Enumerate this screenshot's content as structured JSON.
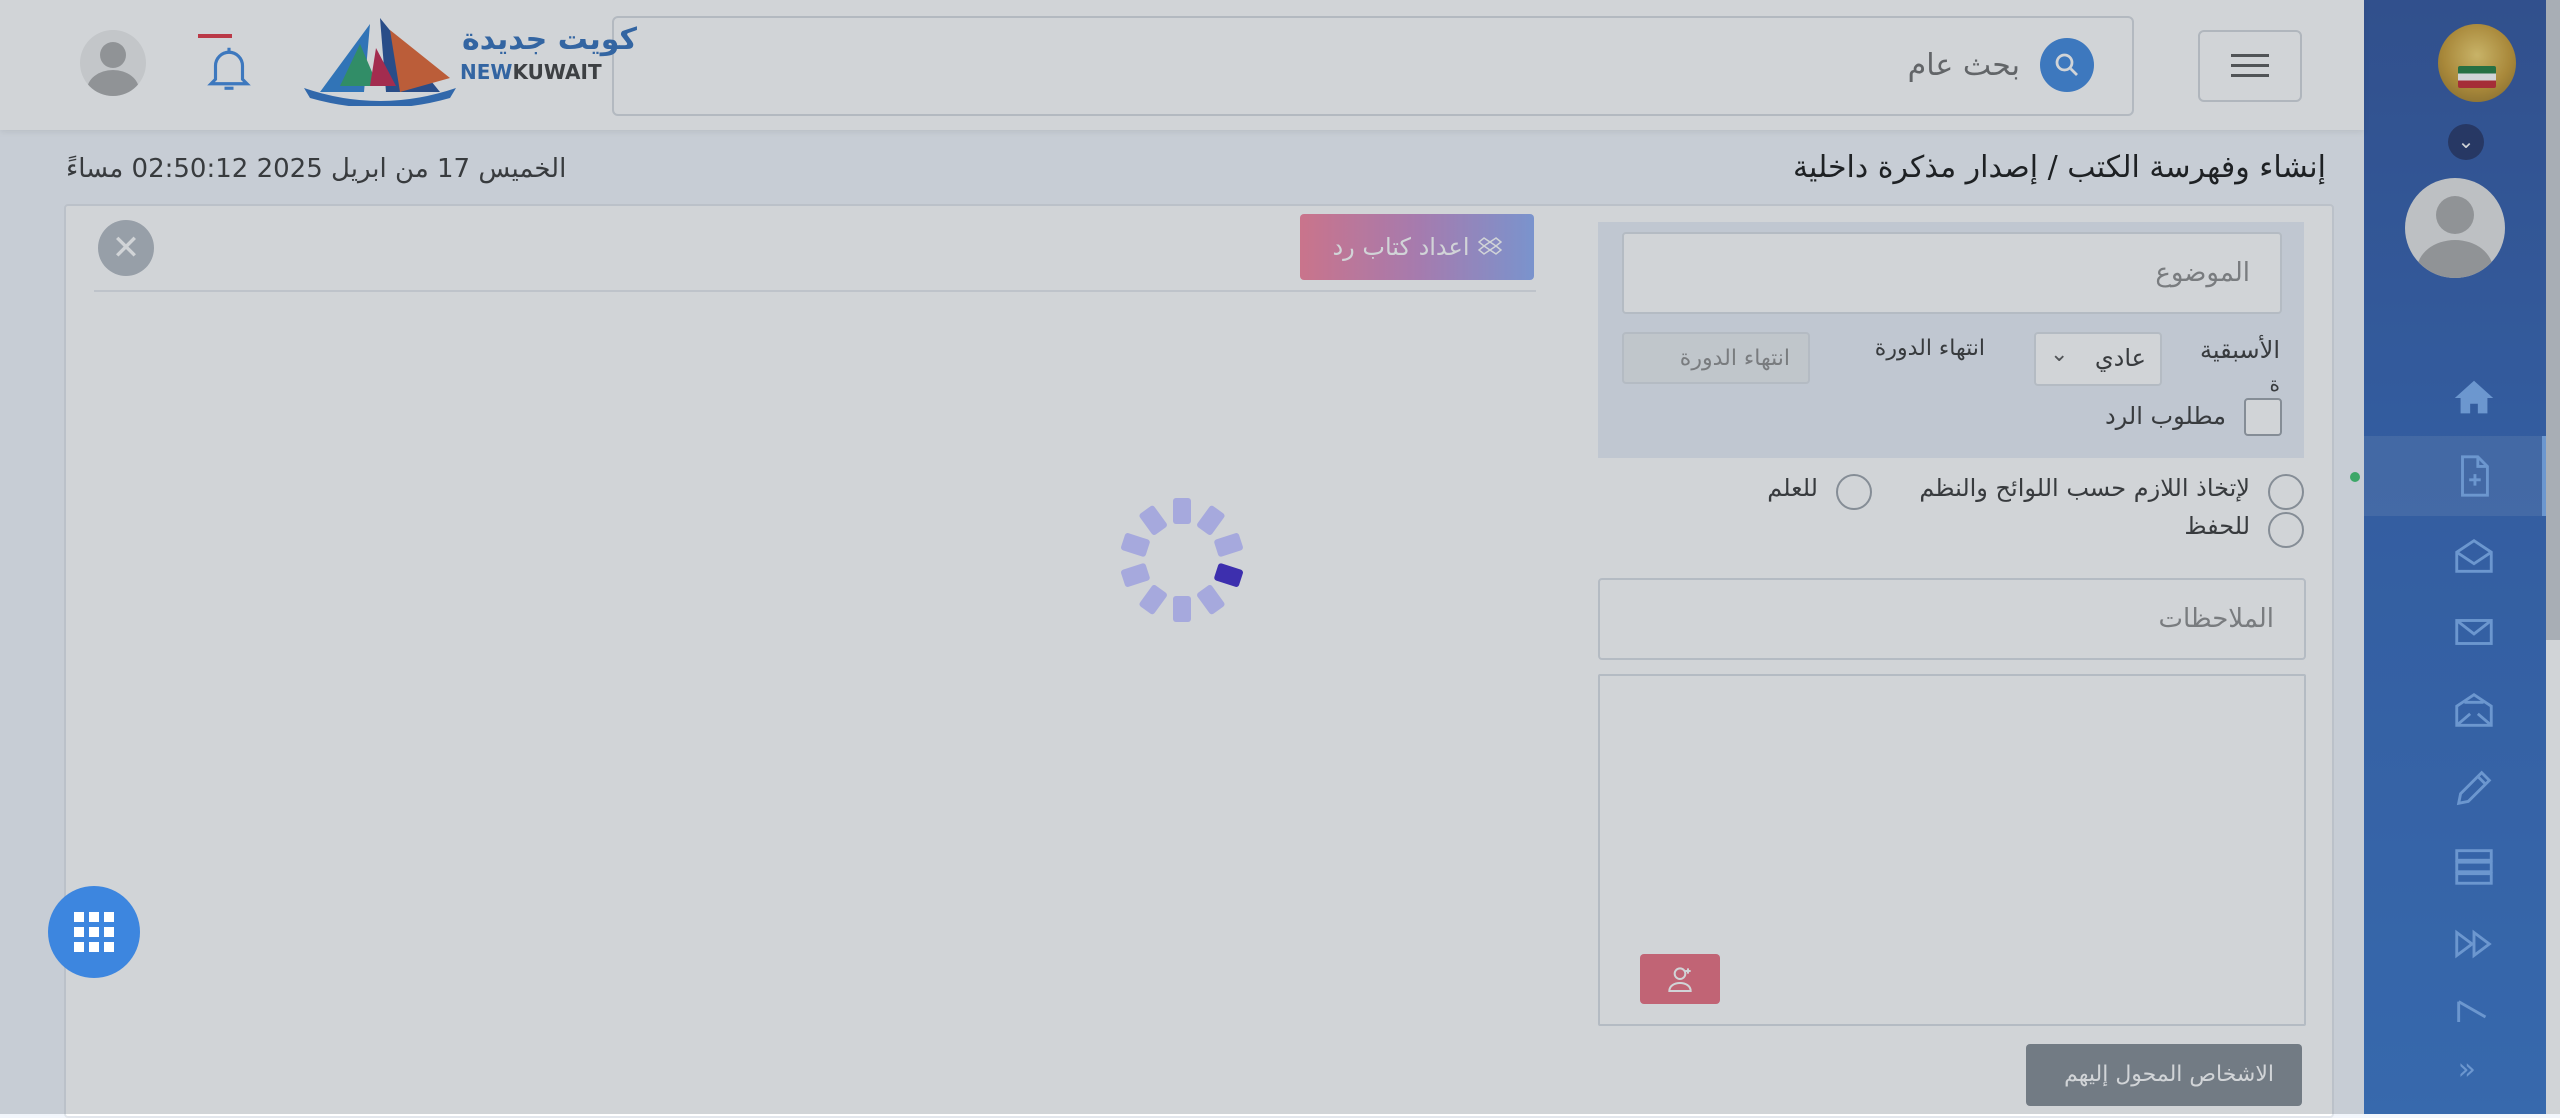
{
  "header": {
    "search_label": "بحث عام",
    "logo_ar": "كويت جديدة",
    "logo_en_new": "NEW",
    "logo_en_kuwait": "KUWAIT"
  },
  "page": {
    "breadcrumb": "إنشاء وفهرسة الكتب / إصدار مذكرة داخلية",
    "datetime": "الخميس 17 من ابريل 2025   02:50:12 مساءً"
  },
  "form": {
    "subject_placeholder": "الموضوع",
    "priority_label": "الأسبقية",
    "priority_value": "عادي",
    "cycle_end_label": "انتهاء الدورة",
    "cycle_end_placeholder": "انتهاء الدورة",
    "reply_required_label": "مطلوب الرد",
    "radio_action": "لإتخاذ اللازم حسب اللوائح والنظم",
    "radio_info": "للعلم",
    "radio_archive": "للحفظ",
    "notes_placeholder": "الملاحظات",
    "transferred_button": "الاشخاص المحول إليهم"
  },
  "preview": {
    "reply_button": "اعداد كتاب رد"
  },
  "colors": {
    "sidebar": "#2d60b5",
    "accent": "#3a84de",
    "danger": "#ea6a7c"
  },
  "icons": {
    "nav": [
      "home-icon",
      "new-document-icon",
      "open-mail-icon",
      "mail-icon",
      "archive-mail-icon",
      "edit-icon",
      "storage-icon",
      "forward-icon",
      "flag-icon"
    ]
  }
}
